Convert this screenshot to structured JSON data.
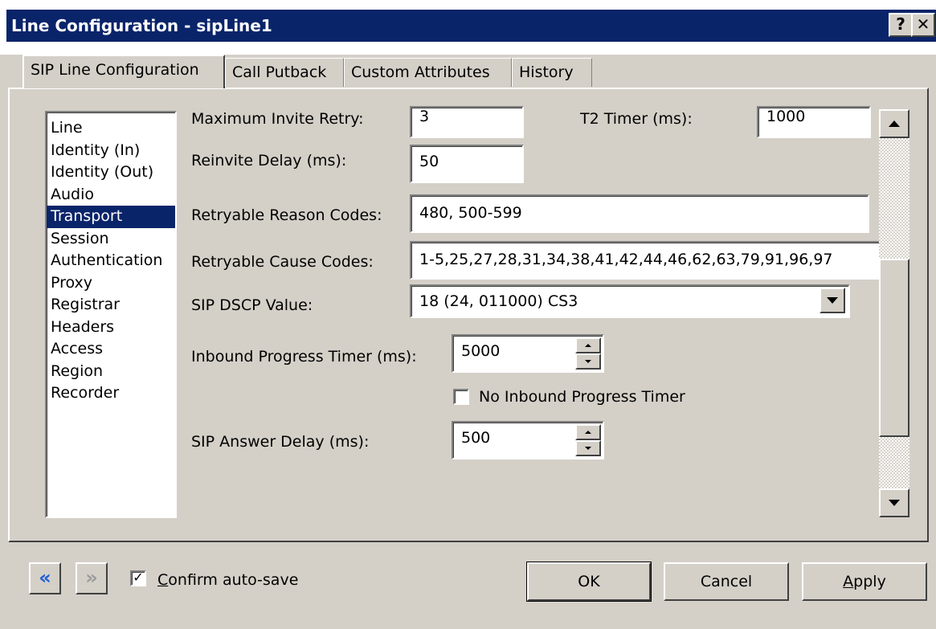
{
  "window": {
    "title": "Line Configuration - sipLine1",
    "help_label": "?",
    "close_label": "✕"
  },
  "tabs": [
    {
      "label": "SIP Line Configuration",
      "active": true
    },
    {
      "label": "Call Putback",
      "active": false
    },
    {
      "label": "Custom Attributes",
      "active": false
    },
    {
      "label": "History",
      "active": false
    }
  ],
  "categories": [
    {
      "label": "Line"
    },
    {
      "label": "Identity (In)"
    },
    {
      "label": "Identity (Out)"
    },
    {
      "label": "Audio"
    },
    {
      "label": "Transport",
      "selected": true
    },
    {
      "label": "Session"
    },
    {
      "label": "Authentication"
    },
    {
      "label": "Proxy"
    },
    {
      "label": "Registrar"
    },
    {
      "label": "Headers"
    },
    {
      "label": "Access"
    },
    {
      "label": "Region"
    },
    {
      "label": "Recorder"
    }
  ],
  "form": {
    "max_invite_retry": {
      "label": "Maximum Invite Retry:",
      "value": "3"
    },
    "t2_timer": {
      "label": "T2 Timer (ms):",
      "value": "1000"
    },
    "reinvite_delay": {
      "label": "Reinvite Delay (ms):",
      "value": "50"
    },
    "retryable_reason_codes": {
      "label": "Retryable Reason Codes:",
      "value": "480, 500-599"
    },
    "retryable_cause_codes": {
      "label": "Retryable Cause Codes:",
      "value": "1-5,25,27,28,31,34,38,41,42,44,46,62,63,79,91,96,97"
    },
    "sip_dscp": {
      "label": "SIP DSCP Value:",
      "value": "18 (24, 011000) CS3"
    },
    "inbound_progress_timer": {
      "label": "Inbound Progress Timer (ms):",
      "value": "5000"
    },
    "no_inbound_progress_timer": {
      "label": "No Inbound Progress Timer",
      "checked": false
    },
    "sip_answer_delay": {
      "label": "SIP Answer Delay (ms):",
      "value": "500"
    }
  },
  "footer": {
    "confirm_autosave": {
      "label_accel": "C",
      "label_rest": "onfirm auto-save",
      "checked": true
    },
    "ok_label": "OK",
    "cancel_label": "Cancel",
    "apply_accel": "A",
    "apply_rest": "pply"
  },
  "colors": {
    "titlebar": "#0a246a",
    "selection": "#0a246a",
    "face": "#d4d0c8",
    "nav_back_icon": "#1f5fd4",
    "nav_forward_icon": "#9c9c9c"
  }
}
